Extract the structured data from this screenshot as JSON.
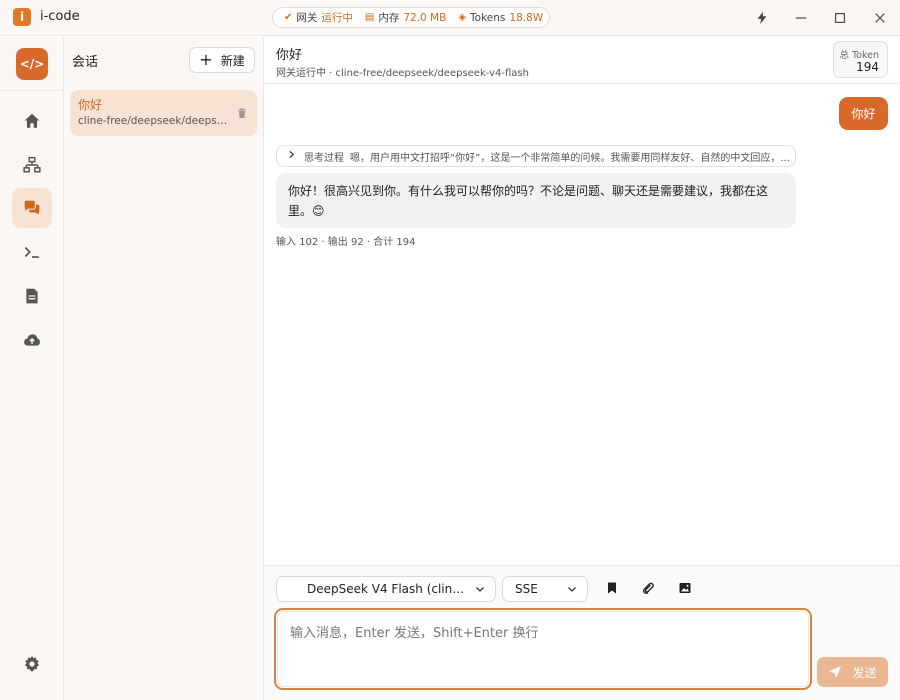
{
  "window": {
    "title": "i-code"
  },
  "status": {
    "gateway_label": "网关",
    "gateway_state": "运行中",
    "memory_label": "内存",
    "memory_value": "72.0 MB",
    "tokens_label": "Tokens",
    "tokens_value": "18.8W"
  },
  "nav": {
    "items": [
      "home",
      "network",
      "chat",
      "terminal",
      "document",
      "cloud-upload"
    ],
    "active": "chat"
  },
  "sessions": {
    "header": "会话",
    "new_label": "新建",
    "items": [
      {
        "title": "你好",
        "subtitle": "cline-free/deepseek/deepseek-v4-flash"
      }
    ]
  },
  "chat": {
    "title": "你好",
    "subtitle": "网关运行中 · cline-free/deepseek/deepseek-v4-flash",
    "token_label": "总 Token",
    "token_value": "194",
    "user_message": "你好",
    "thinking_label": "思考过程",
    "thinking_text": "嗯，用户用中文打招呼“你好”，这是一个非常简单的问候。我需要用同样友好、自然的中文回应，...",
    "assistant_message": "你好！很高兴见到你。有什么我可以帮你的吗？不论是问题、聊天还是需要建议，我都在这里。😊",
    "usage": "输入 102 · 输出 92 · 合计 194"
  },
  "composer": {
    "model_select": "DeepSeek V4 Flash (cline-...",
    "mode_select": "SSE",
    "placeholder": "输入消息，Enter 发送，Shift+Enter 换行",
    "send_label": "发送"
  },
  "colors": {
    "accent": "#d9692a",
    "accent_soft": "#f7e3d3",
    "send_disabled": "#eab693"
  }
}
